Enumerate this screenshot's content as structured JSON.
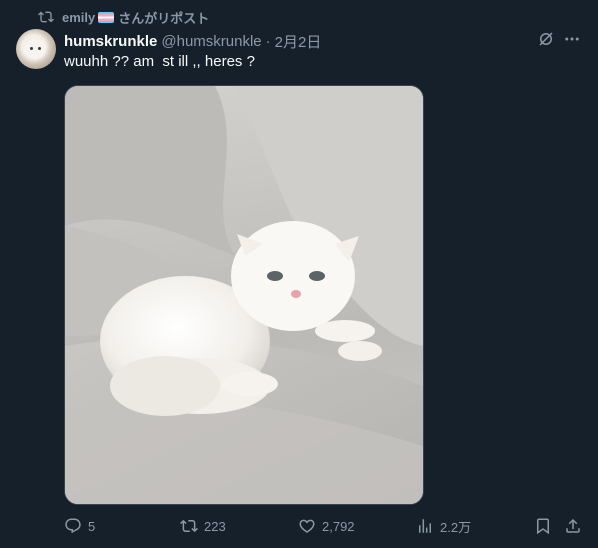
{
  "repost": {
    "user": "emily",
    "suffix": "さんがリポスト"
  },
  "tweet": {
    "display_name": "humskrunkle",
    "handle": "@humskrunkle",
    "separator": "·",
    "date": "2月2日",
    "text": "wuuhh ?? am  st ill ,, heres ?"
  },
  "metrics": {
    "replies": "5",
    "reposts": "223",
    "likes": "2,792",
    "views": "2.2万"
  },
  "icons": {
    "repost_context": "repost-icon",
    "flag": "transgender-flag-icon",
    "grok": "grok-icon",
    "more": "more-icon",
    "reply": "reply-icon",
    "repost": "repost-icon",
    "like": "heart-icon",
    "views": "views-icon",
    "bookmark": "bookmark-icon",
    "share": "share-icon"
  },
  "colors": {
    "background": "#15202b",
    "text_primary": "#f7f9f9",
    "text_secondary": "#8b98a5",
    "border": "#38444d"
  }
}
